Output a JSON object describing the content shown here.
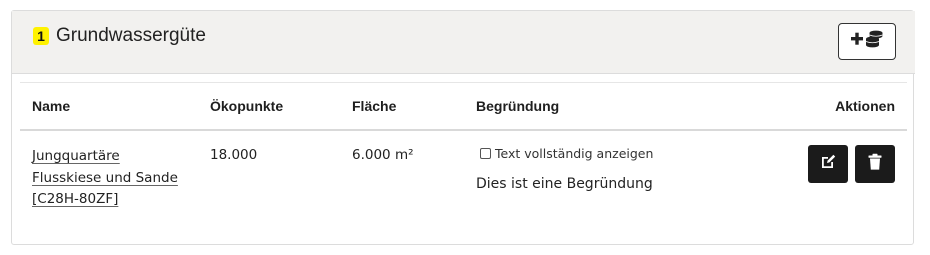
{
  "card": {
    "badge": "1",
    "title": "Grundwassergüte",
    "add_icon": "plus-coins-icon"
  },
  "table": {
    "headers": {
      "name": "Name",
      "oekopunkte": "Ökopunkte",
      "flaeche": "Fläche",
      "begruendung": "Begründung",
      "aktionen": "Aktionen"
    },
    "rows": [
      {
        "name_line1": "Jungquartäre",
        "name_line2": "Flusskiese und Sande",
        "name_line3": "[C28H-80ZF]",
        "oekopunkte": "18.000",
        "flaeche": "6.000 m²",
        "show_full_text_label": "Text vollständig anzeigen",
        "show_full_text_checked": false,
        "begruendung": "Dies ist eine Begründung",
        "edit_icon": "edit-icon",
        "delete_icon": "trash-icon"
      }
    ]
  },
  "colors": {
    "badge": "#fff200",
    "header_bg": "#f2f1ef",
    "action_button": "#1b1b1b"
  }
}
